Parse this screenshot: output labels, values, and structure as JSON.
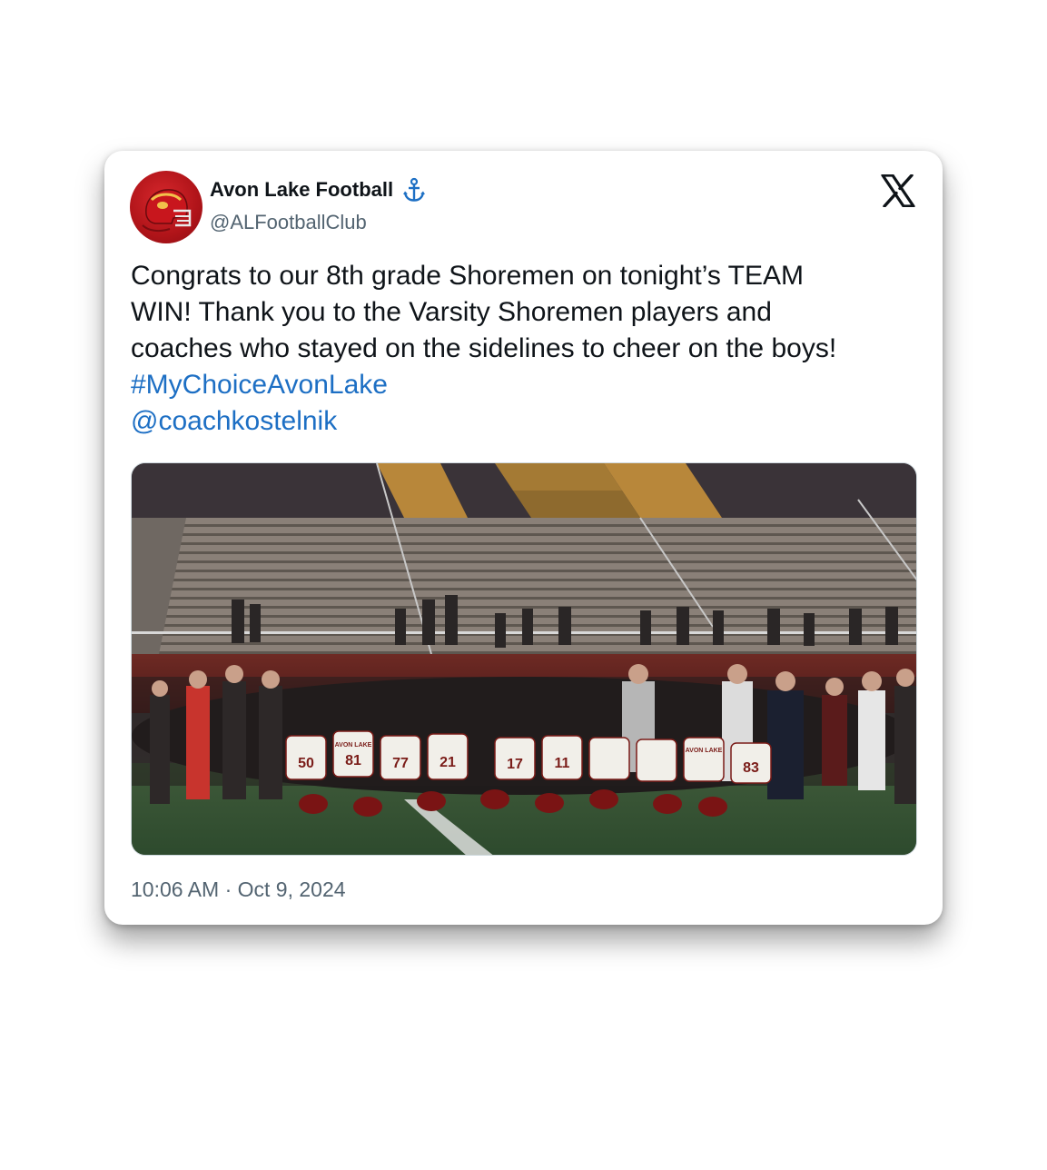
{
  "post": {
    "display_name": "Avon Lake Football",
    "handle": "@ALFootballClub",
    "verified_icon": "anchor-icon",
    "platform_logo": "x-logo-icon",
    "text_lines": [
      "Congrats to our 8th grade Shoremen on tonight’s TEAM",
      "WIN!  Thank you to the Varsity Shoremen players and",
      "coaches who stayed on the sidelines to cheer on the boys!"
    ],
    "hashtag": "#MyChoiceAvonLake",
    "mention": "@coachkostelnik",
    "timestamp": "10:06 AM · Oct 9, 2024",
    "photo_jerseys": [
      "50",
      "81",
      "77",
      "21",
      "17",
      "11",
      "83"
    ],
    "photo_jersey_text": "AVON LAKE"
  },
  "colors": {
    "link": "#1d6fc4",
    "text": "#0f1419",
    "muted": "#536471",
    "brand_red": "#b01419"
  }
}
